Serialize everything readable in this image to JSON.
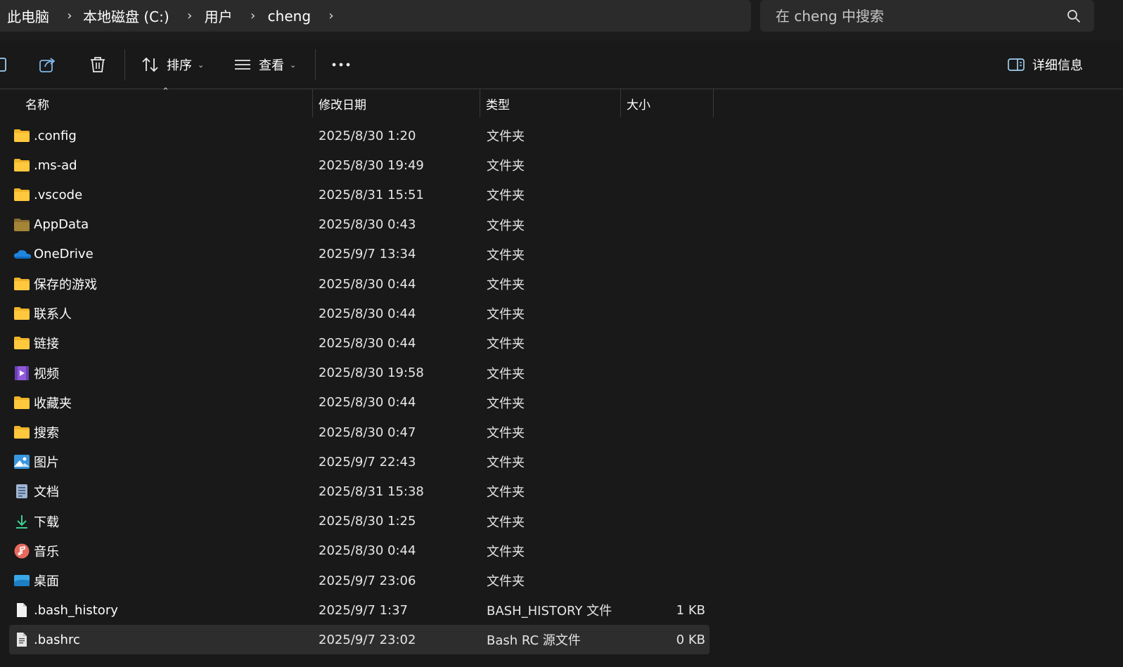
{
  "breadcrumb": {
    "items": [
      "此电脑",
      "本地磁盘 (C:)",
      "用户",
      "cheng"
    ]
  },
  "search": {
    "placeholder": "在 cheng 中搜索"
  },
  "toolbar": {
    "sort_label": "排序",
    "view_label": "查看",
    "details_label": "详细信息"
  },
  "columns": {
    "name": "名称",
    "date": "修改日期",
    "type": "类型",
    "size": "大小"
  },
  "files": [
    {
      "name": ".config",
      "date": "2025/8/30 1:20",
      "type": "文件夹",
      "size": "",
      "icon": "folder-icon"
    },
    {
      "name": ".ms-ad",
      "date": "2025/8/30 19:49",
      "type": "文件夹",
      "size": "",
      "icon": "folder-icon"
    },
    {
      "name": ".vscode",
      "date": "2025/8/31 15:51",
      "type": "文件夹",
      "size": "",
      "icon": "folder-icon"
    },
    {
      "name": "AppData",
      "date": "2025/8/30 0:43",
      "type": "文件夹",
      "size": "",
      "icon": "hidden-folder-icon"
    },
    {
      "name": "OneDrive",
      "date": "2025/9/7 13:34",
      "type": "文件夹",
      "size": "",
      "icon": "onedrive-cloud-icon"
    },
    {
      "name": "保存的游戏",
      "date": "2025/8/30 0:44",
      "type": "文件夹",
      "size": "",
      "icon": "folder-icon"
    },
    {
      "name": "联系人",
      "date": "2025/8/30 0:44",
      "type": "文件夹",
      "size": "",
      "icon": "folder-icon"
    },
    {
      "name": "链接",
      "date": "2025/8/30 0:44",
      "type": "文件夹",
      "size": "",
      "icon": "folder-icon"
    },
    {
      "name": "视频",
      "date": "2025/8/30 19:58",
      "type": "文件夹",
      "size": "",
      "icon": "video-folder-icon"
    },
    {
      "name": "收藏夹",
      "date": "2025/8/30 0:44",
      "type": "文件夹",
      "size": "",
      "icon": "folder-icon"
    },
    {
      "name": "搜索",
      "date": "2025/8/30 0:47",
      "type": "文件夹",
      "size": "",
      "icon": "folder-icon"
    },
    {
      "name": "图片",
      "date": "2025/9/7 22:43",
      "type": "文件夹",
      "size": "",
      "icon": "pictures-folder-icon"
    },
    {
      "name": "文档",
      "date": "2025/8/31 15:38",
      "type": "文件夹",
      "size": "",
      "icon": "documents-folder-icon"
    },
    {
      "name": "下载",
      "date": "2025/8/30 1:25",
      "type": "文件夹",
      "size": "",
      "icon": "download-arrow-icon"
    },
    {
      "name": "音乐",
      "date": "2025/8/30 0:44",
      "type": "文件夹",
      "size": "",
      "icon": "music-folder-icon"
    },
    {
      "name": "桌面",
      "date": "2025/9/7 23:06",
      "type": "文件夹",
      "size": "",
      "icon": "desktop-folder-icon"
    },
    {
      "name": ".bash_history",
      "date": "2025/9/7 1:37",
      "type": "BASH_HISTORY 文件",
      "size": "1 KB",
      "icon": "blank-file-icon"
    },
    {
      "name": ".bashrc",
      "date": "2025/9/7 23:02",
      "type": "Bash RC 源文件",
      "size": "0 KB",
      "icon": "text-file-icon",
      "selected": true
    }
  ],
  "colors": {
    "background": "#191919",
    "folder": "#f5c02e",
    "selection": "#2d2d2d",
    "accent": "#60cdff"
  }
}
